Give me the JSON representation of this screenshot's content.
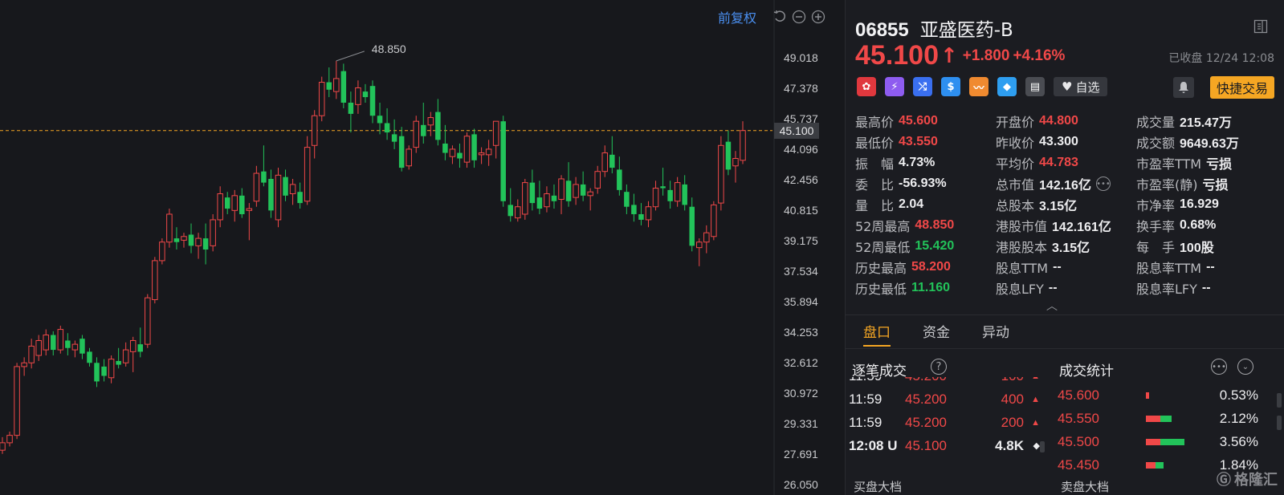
{
  "chart_toolbar": {
    "adjust_label": "前复权"
  },
  "chart_data": {
    "type": "candlestick",
    "y_ticks": [
      "49.018",
      "47.378",
      "45.737",
      "44.096",
      "42.456",
      "40.815",
      "39.175",
      "37.534",
      "35.894",
      "34.253",
      "32.612",
      "30.972",
      "29.331",
      "27.691",
      "26.050"
    ],
    "ylim": [
      26.05,
      49.018
    ],
    "high_annotation": "48.850",
    "current_price_label": "45.100",
    "current_price": 45.1,
    "candles": [
      [
        27.9,
        28.6,
        27.7,
        28.3
      ],
      [
        28.3,
        28.9,
        28.1,
        28.7
      ],
      [
        28.7,
        32.6,
        28.5,
        32.4
      ],
      [
        32.4,
        32.9,
        31.9,
        32.6
      ],
      [
        32.6,
        33.9,
        32.3,
        33.5
      ],
      [
        33.0,
        34.1,
        32.7,
        33.8
      ],
      [
        33.3,
        34.4,
        33.0,
        34.1
      ],
      [
        34.1,
        34.3,
        33.0,
        33.3
      ],
      [
        33.3,
        34.6,
        33.1,
        34.4
      ],
      [
        33.8,
        34.2,
        33.0,
        33.4
      ],
      [
        33.3,
        33.8,
        32.9,
        33.6
      ],
      [
        33.9,
        34.1,
        32.8,
        33.1
      ],
      [
        33.2,
        33.4,
        32.4,
        32.6
      ],
      [
        32.6,
        32.9,
        31.3,
        31.6
      ],
      [
        32.4,
        32.8,
        31.6,
        31.9
      ],
      [
        31.8,
        33.0,
        31.5,
        32.8
      ],
      [
        32.7,
        33.4,
        32.3,
        32.5
      ],
      [
        32.6,
        33.7,
        32.4,
        33.3
      ],
      [
        33.2,
        34.0,
        32.1,
        33.8
      ],
      [
        33.6,
        34.5,
        32.9,
        33.2
      ],
      [
        33.6,
        36.3,
        33.4,
        36.1
      ],
      [
        36.0,
        38.3,
        35.8,
        38.1
      ],
      [
        38.1,
        39.3,
        37.9,
        39.1
      ],
      [
        39.1,
        40.9,
        38.8,
        40.6
      ],
      [
        39.3,
        39.9,
        38.7,
        39.1
      ],
      [
        39.2,
        39.6,
        38.8,
        39.4
      ],
      [
        39.5,
        40.1,
        38.5,
        38.9
      ],
      [
        38.9,
        39.6,
        38.2,
        39.3
      ],
      [
        39.3,
        40.1,
        37.9,
        38.7
      ],
      [
        38.9,
        40.6,
        38.6,
        40.3
      ],
      [
        40.3,
        42.1,
        39.9,
        41.7
      ],
      [
        41.5,
        41.8,
        40.6,
        40.9
      ],
      [
        40.8,
        41.9,
        40.2,
        41.6
      ],
      [
        41.6,
        42.0,
        40.4,
        40.6
      ],
      [
        40.8,
        41.2,
        39.2,
        40.9
      ],
      [
        41.3,
        43.2,
        41.0,
        42.8
      ],
      [
        42.9,
        44.3,
        42.1,
        42.3
      ],
      [
        42.5,
        43.0,
        40.4,
        40.8
      ],
      [
        40.3,
        43.1,
        39.9,
        42.7
      ],
      [
        42.6,
        43.0,
        41.3,
        41.6
      ],
      [
        41.7,
        42.5,
        41.1,
        42.2
      ],
      [
        41.8,
        42.3,
        40.9,
        41.2
      ],
      [
        41.3,
        44.8,
        41.1,
        44.2
      ],
      [
        44.3,
        46.2,
        43.6,
        45.9
      ],
      [
        45.9,
        48.0,
        45.6,
        47.7
      ],
      [
        47.7,
        48.5,
        46.9,
        47.3
      ],
      [
        47.2,
        48.85,
        46.8,
        47.9
      ],
      [
        48.3,
        48.7,
        46.3,
        46.6
      ],
      [
        46.6,
        47.2,
        45.0,
        46.0
      ],
      [
        46.5,
        47.8,
        46.0,
        47.4
      ],
      [
        47.2,
        47.6,
        46.6,
        46.9
      ],
      [
        47.5,
        47.8,
        45.5,
        45.9
      ],
      [
        45.9,
        46.6,
        44.9,
        45.5
      ],
      [
        45.5,
        46.3,
        44.6,
        45.0
      ],
      [
        44.9,
        45.7,
        44.1,
        44.5
      ],
      [
        44.8,
        45.3,
        42.9,
        43.1
      ],
      [
        43.2,
        44.3,
        43.0,
        44.1
      ],
      [
        44.2,
        45.9,
        43.9,
        45.6
      ],
      [
        45.4,
        46.6,
        44.4,
        44.8
      ],
      [
        45.4,
        46.1,
        44.8,
        45.8
      ],
      [
        46.1,
        46.8,
        44.3,
        44.6
      ],
      [
        44.4,
        45.4,
        43.5,
        43.9
      ],
      [
        43.7,
        44.3,
        43.3,
        44.1
      ],
      [
        43.9,
        44.4,
        43.1,
        43.6
      ],
      [
        43.4,
        45.0,
        43.1,
        44.8
      ],
      [
        44.9,
        45.2,
        43.1,
        43.5
      ],
      [
        43.8,
        44.2,
        43.3,
        43.9
      ],
      [
        43.8,
        44.6,
        43.2,
        44.1
      ],
      [
        44.3,
        44.8,
        43.6,
        45.6
      ],
      [
        45.6,
        45.9,
        41.0,
        41.3
      ],
      [
        41.1,
        42.0,
        40.2,
        40.5
      ],
      [
        40.4,
        41.4,
        40.2,
        41.0
      ],
      [
        40.6,
        42.5,
        40.3,
        42.3
      ],
      [
        42.3,
        43.0,
        40.8,
        41.2
      ],
      [
        41.5,
        42.4,
        40.6,
        40.9
      ],
      [
        41.0,
        42.1,
        40.7,
        41.7
      ],
      [
        41.6,
        42.2,
        40.9,
        41.3
      ],
      [
        41.4,
        42.7,
        40.6,
        42.5
      ],
      [
        42.4,
        43.4,
        41.0,
        41.3
      ],
      [
        41.5,
        42.6,
        41.1,
        42.2
      ],
      [
        42.2,
        42.9,
        41.3,
        41.6
      ],
      [
        41.6,
        42.0,
        40.8,
        41.8
      ],
      [
        42.0,
        43.2,
        41.7,
        42.9
      ],
      [
        42.9,
        44.3,
        42.6,
        43.9
      ],
      [
        43.8,
        44.8,
        42.8,
        43.1
      ],
      [
        43.0,
        43.7,
        41.6,
        41.9
      ],
      [
        41.8,
        42.2,
        40.6,
        41.0
      ],
      [
        41.1,
        41.7,
        40.2,
        40.6
      ],
      [
        40.6,
        41.2,
        40.0,
        40.3
      ],
      [
        40.3,
        41.3,
        39.9,
        41.0
      ],
      [
        41.0,
        42.4,
        40.8,
        42.0
      ],
      [
        42.1,
        43.1,
        41.6,
        42.0
      ],
      [
        41.9,
        42.4,
        40.9,
        41.3
      ],
      [
        41.3,
        42.6,
        41.0,
        42.3
      ],
      [
        42.2,
        42.7,
        40.8,
        41.1
      ],
      [
        41.0,
        41.5,
        38.6,
        38.9
      ],
      [
        38.8,
        39.3,
        37.8,
        39.1
      ],
      [
        39.1,
        40.0,
        38.5,
        39.6
      ],
      [
        39.4,
        41.3,
        39.2,
        41.1
      ],
      [
        41.2,
        44.8,
        40.8,
        44.3
      ],
      [
        44.5,
        45.1,
        42.7,
        43.0
      ],
      [
        43.2,
        44.0,
        42.3,
        43.6
      ],
      [
        43.5,
        45.6,
        43.3,
        45.1
      ]
    ]
  },
  "quote": {
    "code": "06855",
    "name": "亚盛医药-B",
    "price": "45.100",
    "arrow": "↑",
    "change": "+1.800",
    "change_pct": "+4.16%",
    "status": "已收盘 12/24 12:08",
    "fav_label": "自选",
    "quick_trade_label": "快捷交易"
  },
  "stats": [
    [
      {
        "label": "最高价",
        "value": "45.600",
        "color": "red"
      },
      {
        "label": "开盘价",
        "value": "44.800",
        "color": "red"
      },
      {
        "label": "成交量",
        "value": "215.47万",
        "color": ""
      }
    ],
    [
      {
        "label": "最低价",
        "value": "43.550",
        "color": "red"
      },
      {
        "label": "昨收价",
        "value": "43.300",
        "color": ""
      },
      {
        "label": "成交额",
        "value": "9649.63万",
        "color": ""
      }
    ],
    [
      {
        "label": "振　幅",
        "value": "4.73%",
        "color": ""
      },
      {
        "label": "平均价",
        "value": "44.783",
        "color": "red"
      },
      {
        "label": "市盈率TTM",
        "value": "亏损",
        "color": ""
      }
    ],
    [
      {
        "label": "委　比",
        "value": "-56.93%",
        "color": ""
      },
      {
        "label": "总市值",
        "value": "142.16亿",
        "color": "",
        "more": true
      },
      {
        "label": "市盈率(静)",
        "value": "亏损",
        "color": ""
      }
    ],
    [
      {
        "label": "量　比",
        "value": "2.04",
        "color": ""
      },
      {
        "label": "总股本",
        "value": "3.15亿",
        "color": ""
      },
      {
        "label": "市净率",
        "value": "16.929",
        "color": ""
      }
    ],
    [
      {
        "label": "52周最高",
        "value": "48.850",
        "color": "red"
      },
      {
        "label": "港股市值",
        "value": "142.161亿",
        "color": ""
      },
      {
        "label": "换手率",
        "value": "0.68%",
        "color": ""
      }
    ],
    [
      {
        "label": "52周最低",
        "value": "15.420",
        "color": "green"
      },
      {
        "label": "港股股本",
        "value": "3.15亿",
        "color": ""
      },
      {
        "label": "每　手",
        "value": "100股",
        "color": ""
      }
    ],
    [
      {
        "label": "历史最高",
        "value": "58.200",
        "color": "red"
      },
      {
        "label": "股息TTM",
        "value": "--",
        "color": ""
      },
      {
        "label": "股息率TTM",
        "value": "--",
        "color": ""
      }
    ],
    [
      {
        "label": "历史最低",
        "value": "11.160",
        "color": "green"
      },
      {
        "label": "股息LFY",
        "value": "--",
        "color": ""
      },
      {
        "label": "股息率LFY",
        "value": "--",
        "color": ""
      }
    ]
  ],
  "tabs": [
    "盘口",
    "资金",
    "异动"
  ],
  "ticks_title": "逐笔成交",
  "vol_title": "成交统计",
  "ticks": [
    {
      "time": "11:59",
      "price": "45.200",
      "vol": "100",
      "dir": "▲"
    },
    {
      "time": "11:59",
      "price": "45.200",
      "vol": "400",
      "dir": "▲"
    },
    {
      "time": "11:59",
      "price": "45.200",
      "vol": "200",
      "dir": "▲"
    },
    {
      "time": "12:08 U",
      "price": "45.100",
      "vol": "4.8K",
      "dir": "◆",
      "bold": true
    }
  ],
  "vol_stats": [
    {
      "price": "45.600",
      "pct": "0.53%",
      "red": 0.05,
      "green": 0.0
    },
    {
      "price": "45.550",
      "pct": "2.12%",
      "red": 0.22,
      "green": 0.18
    },
    {
      "price": "45.500",
      "pct": "3.56%",
      "red": 0.22,
      "green": 0.38
    },
    {
      "price": "45.450",
      "pct": "1.84%",
      "red": 0.15,
      "green": 0.12
    }
  ],
  "bottom": {
    "buy": "买盘大档",
    "sell": "卖盘大档"
  },
  "watermark": "格隆汇",
  "colors": {
    "up": "#f04848",
    "down": "#22c35a",
    "accent": "#f5a623",
    "link": "#4a8ff0"
  }
}
